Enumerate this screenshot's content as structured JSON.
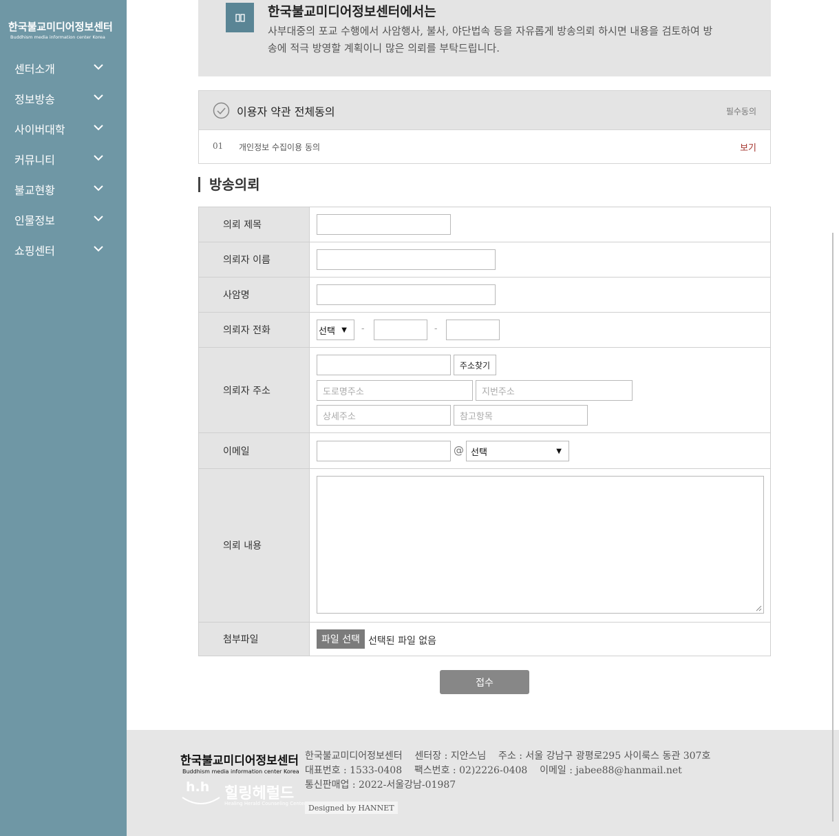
{
  "sidebar": {
    "logo_kr": "한국불교미디어정보센터",
    "logo_en": "Buddhism media information center Korea",
    "items": [
      {
        "label": "센터소개"
      },
      {
        "label": "정보방송"
      },
      {
        "label": "사이버대학"
      },
      {
        "label": "커뮤니티"
      },
      {
        "label": "불교현황"
      },
      {
        "label": "인물정보"
      },
      {
        "label": "쇼핑센터"
      }
    ]
  },
  "intro": {
    "title": "한국불교미디어정보센터에서는",
    "text": "사부대중의 포교 수행에서 사암행사, 불사, 야단법속 등을 자유롭게 방송의뢰 하시면 내용을 검토하여 방송에 적극 방영할 계획이니 많은 의뢰를 부탁드립니다."
  },
  "agreement": {
    "all_label": "이용자 약관 전체동의",
    "required": "필수동의",
    "items": [
      {
        "num": "01",
        "label": "개인정보 수집이용 동의",
        "view": "보기"
      }
    ]
  },
  "section_title": "방송의뢰",
  "form": {
    "subject_label": "의뢰 제목",
    "name_label": "의뢰자 이름",
    "temple_label": "사암명",
    "phone_label": "의뢰자 전화",
    "phone_select": "선택",
    "phone_dash": "-",
    "address_label": "의뢰자 주소",
    "address_button": "주소찾기",
    "road_placeholder": "도로명주소",
    "jibun_placeholder": "지번주소",
    "detail_placeholder": "상세주소",
    "ref_placeholder": "참고항목",
    "email_label": "이메일",
    "email_at": "@",
    "email_select": "선택",
    "content_label": "의뢰 내용",
    "file_label": "첨부파일",
    "file_button": "파일 선택",
    "file_status": "선택된 파일 없음"
  },
  "submit_label": "접수",
  "footer": {
    "logo_kr": "한국불교미디어정보센터",
    "logo_en": "Buddhism media information center Korea",
    "partner_kr": "힐링헤럴드",
    "partner_en": "Healing Herald Counseling Center",
    "partner_mark": "h.h",
    "line1": "한국불교미디어정보센터    센터장 : 지안스님    주소 : 서울 강남구 광평로295 사이룩스 동관 307호",
    "line2": "대표번호 : 1533-0408    팩스번호 : 02)2226-0408    이메일 : jabee88@hanmail.net",
    "line3": "통신판매업 : 2022-서울강남-01987",
    "designed": "Designed by HANNET"
  },
  "colors": {
    "sidebar": "#6f97a5",
    "intro_bg": "#e4e4e4",
    "icon_bg": "#5a8595",
    "view_link": "#a3332c",
    "submit": "#878787"
  }
}
